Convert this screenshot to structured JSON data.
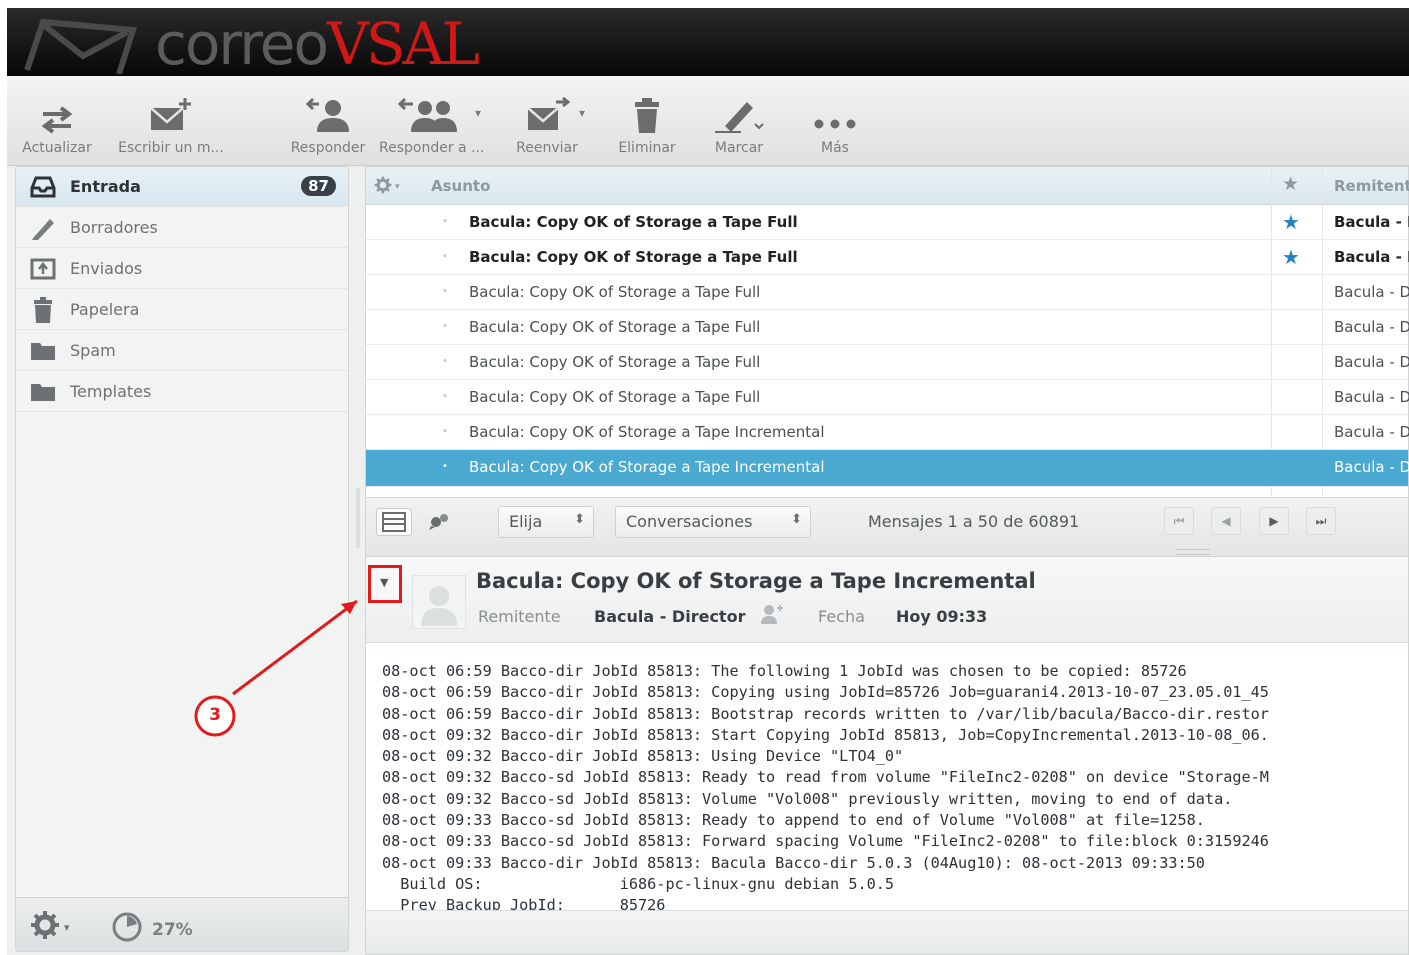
{
  "app": {
    "name_part1": "correo",
    "name_part2": "VSAL"
  },
  "toolbar": {
    "refresh": "Actualizar",
    "compose": "Escribir un m...",
    "reply": "Responder",
    "reply_all": "Responder a ...",
    "forward": "Reenviar",
    "delete": "Eliminar",
    "mark": "Marcar",
    "more": "Más"
  },
  "folders": [
    {
      "label": "Entrada",
      "icon": "inbox-icon",
      "badge": "87",
      "selected": true
    },
    {
      "label": "Borradores",
      "icon": "pencil-icon"
    },
    {
      "label": "Enviados",
      "icon": "sent-icon"
    },
    {
      "label": "Papelera",
      "icon": "trash-icon"
    },
    {
      "label": "Spam",
      "icon": "folder-icon"
    },
    {
      "label": "Templates",
      "icon": "folder-icon"
    }
  ],
  "folder_footer": {
    "quota": "27%"
  },
  "list": {
    "header": {
      "subject": "Asunto",
      "from": "Remitente"
    },
    "rows": [
      {
        "subject": "Bacula: Copy OK of Storage a Tape Full",
        "from": "Bacula - Director",
        "unread": true,
        "flagged": true
      },
      {
        "subject": "Bacula: Copy OK of Storage a Tape Full",
        "from": "Bacula - Director",
        "unread": true,
        "flagged": true
      },
      {
        "subject": "Bacula: Copy OK of Storage a Tape Full",
        "from": "Bacula - Director"
      },
      {
        "subject": "Bacula: Copy OK of Storage a Tape Full",
        "from": "Bacula - Director"
      },
      {
        "subject": "Bacula: Copy OK of Storage a Tape Full",
        "from": "Bacula - Director"
      },
      {
        "subject": "Bacula: Copy OK of Storage a Tape Full",
        "from": "Bacula - Director"
      },
      {
        "subject": "Bacula: Copy OK of Storage a Tape Incremental",
        "from": "Bacula - Director"
      },
      {
        "subject": "Bacula: Copy OK of Storage a Tape Incremental",
        "from": "Bacula - Director",
        "selected": true
      }
    ],
    "footer": {
      "select_label": "Elija",
      "threads_label": "Conversaciones",
      "pager_text": "Mensajes 1 a 50 de 60891"
    }
  },
  "preview": {
    "subject": "Bacula: Copy OK of Storage a Tape Incremental",
    "from_label": "Remitente",
    "from_value": "Bacula - Director",
    "date_label": "Fecha",
    "date_value": "Hoy 09:33",
    "body": "08-oct 06:59 Bacco-dir JobId 85813: The following 1 JobId was chosen to be copied: 85726\n08-oct 06:59 Bacco-dir JobId 85813: Copying using JobId=85726 Job=guarani4.2013-10-07_23.05.01_45\n08-oct 06:59 Bacco-dir JobId 85813: Bootstrap records written to /var/lib/bacula/Bacco-dir.restor\n08-oct 09:32 Bacco-dir JobId 85813: Start Copying JobId 85813, Job=CopyIncremental.2013-10-08_06.\n08-oct 09:32 Bacco-dir JobId 85813: Using Device \"LTO4_0\"\n08-oct 09:32 Bacco-sd JobId 85813: Ready to read from volume \"FileInc2-0208\" on device \"Storage-M\n08-oct 09:32 Bacco-sd JobId 85813: Volume \"Vol008\" previously written, moving to end of data.\n08-oct 09:33 Bacco-sd JobId 85813: Ready to append to end of Volume \"Vol008\" at file=1258.\n08-oct 09:33 Bacco-sd JobId 85813: Forward spacing Volume \"FileInc2-0208\" to file:block 0:3159246\n08-oct 09:33 Bacco-dir JobId 85813: Bacula Bacco-dir 5.0.3 (04Aug10): 08-oct-2013 09:33:50\n  Build OS:               i686-pc-linux-gnu debian 5.0.5\n  Prev Backup JobId:      85726"
  },
  "annotation": {
    "number": "3",
    "color": "#e21a1a"
  }
}
